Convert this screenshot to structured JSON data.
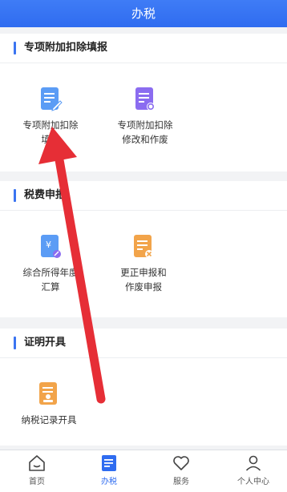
{
  "header": {
    "title": "办税"
  },
  "sections": [
    {
      "title": "专项附加扣除填报",
      "items": [
        {
          "line1": "专项附加扣除",
          "line2": "填报",
          "icon": "document-edit-icon"
        },
        {
          "line1": "专项附加扣除",
          "line2": "修改和作废",
          "icon": "document-settings-icon"
        }
      ]
    },
    {
      "title": "税费申报",
      "items": [
        {
          "line1": "综合所得年度",
          "line2": "汇算",
          "icon": "yuan-document-icon"
        },
        {
          "line1": "更正申报和",
          "line2": "作废申报",
          "icon": "document-cancel-icon"
        }
      ]
    },
    {
      "title": "证明开具",
      "items": [
        {
          "line1": "纳税记录开具",
          "line2": "",
          "icon": "certificate-icon"
        }
      ]
    }
  ],
  "tabbar": {
    "tabs": [
      {
        "label": "首页",
        "icon": "home-icon"
      },
      {
        "label": "办税",
        "icon": "tax-document-icon",
        "active": true
      },
      {
        "label": "服务",
        "icon": "heart-icon"
      },
      {
        "label": "个人中心",
        "icon": "user-icon"
      }
    ]
  },
  "colors": {
    "brand": "#2f6cf0",
    "arrow": "#e62e36",
    "section_bar": "#3b74f1"
  }
}
